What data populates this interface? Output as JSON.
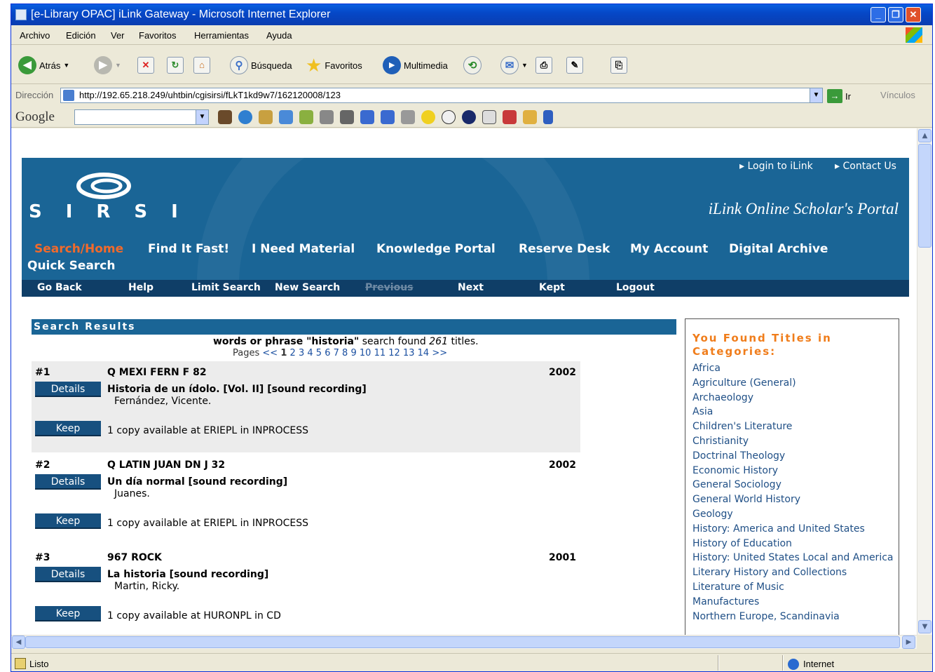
{
  "window": {
    "title": "[e-Library OPAC] iLink Gateway - Microsoft Internet Explorer"
  },
  "menu": [
    "Archivo",
    "Edición",
    "Ver",
    "Favoritos",
    "Herramientas",
    "Ayuda"
  ],
  "toolbar": {
    "back": "Atrás",
    "search": "Búsqueda",
    "favorites": "Favoritos",
    "media": "Multimedia"
  },
  "address": {
    "label": "Dirección",
    "url": "http://192.65.218.249/uhtbin/cgisirsi/fLkT1kd9w7/162120008/123",
    "go": "Ir",
    "links": "Vínculos"
  },
  "google": {
    "label": "Google"
  },
  "status": {
    "text": "Listo",
    "zone": "Internet"
  },
  "header": {
    "brand": "SIRSI",
    "portal": "iLink Online Scholar's Portal",
    "login": "Login to iLink",
    "contact": "Contact Us",
    "nav": [
      "Search/Home",
      "Find It Fast!",
      "I Need Material",
      "Knowledge Portal",
      "Reserve Desk",
      "My Account",
      "Digital Archive"
    ],
    "quick": "Quick Search"
  },
  "subnav": [
    "Go Back",
    "Help",
    "Limit Search",
    "New Search",
    "Previous",
    "Next",
    "Kept",
    "Logout"
  ],
  "results": {
    "heading": "Search Results",
    "summary_pre": "words or phrase ",
    "query": "\"historia\"",
    "summary_mid": " search found ",
    "count": "261",
    "summary_post": " titles.",
    "pages_label": "Pages",
    "pages": [
      "<<",
      "1",
      "2",
      "3",
      "4",
      "5",
      "6",
      "7",
      "8",
      "9",
      "10",
      "11",
      "12",
      "13",
      "14",
      ">>"
    ],
    "details": "Details",
    "keep": "Keep",
    "items": [
      {
        "num": "#1",
        "call": "Q MEXI FERN F 82",
        "year": "2002",
        "title": "Historia de un ídolo. [Vol. II] [sound recording]",
        "author": "Fernández, Vicente.",
        "avail": "1 copy available at ERIEPL in INPROCESS"
      },
      {
        "num": "#2",
        "call": "Q LATIN JUAN DN J 32",
        "year": "2002",
        "title": "Un día normal [sound recording]",
        "author": "Juanes.",
        "avail": "1 copy available at ERIEPL in INPROCESS"
      },
      {
        "num": "#3",
        "call": "967 ROCK",
        "year": "2001",
        "title": "La historia [sound recording]",
        "author": "Martin, Ricky.",
        "avail": "1 copy available at HURONPL in CD"
      }
    ]
  },
  "categories": {
    "heading": "You Found Titles in Categories:",
    "items": [
      "Africa",
      "Agriculture (General)",
      "Archaeology",
      "Asia",
      "Children's Literature",
      "Christianity",
      "Doctrinal Theology",
      "Economic History",
      "General Sociology",
      "General World History",
      "Geology",
      "History: America and United States",
      "History of Education",
      "History: United States Local and America",
      "Literary History and Collections",
      "Literature of Music",
      "Manufactures",
      "Northern Europe, Scandinavia"
    ]
  },
  "colors": {
    "header": "#1a6596",
    "subnav": "#0f3e67",
    "active_nav": "#f26a2b",
    "category_heading": "#f07d1b",
    "button": "#17507f"
  }
}
